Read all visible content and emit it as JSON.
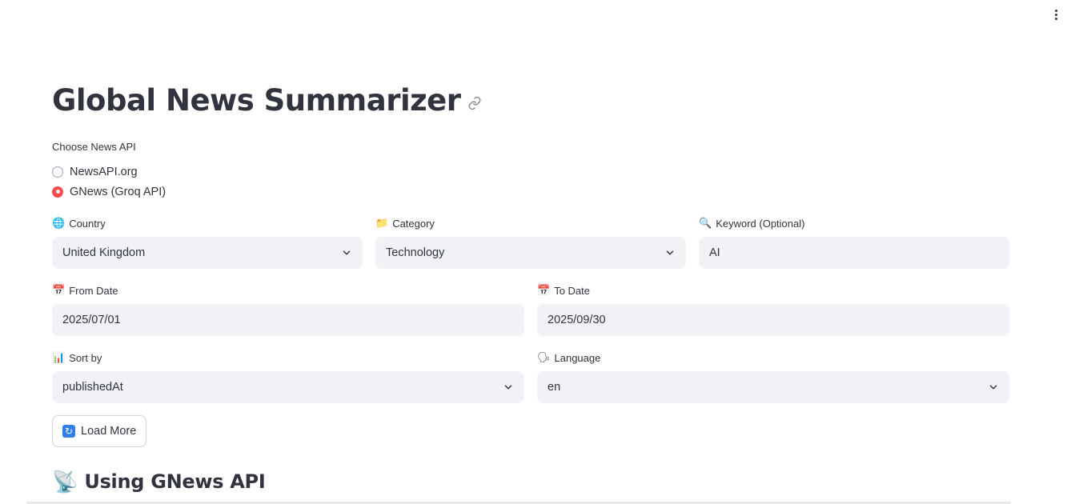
{
  "page": {
    "title": "Global News Summarizer",
    "link_icon": "link-icon",
    "menu_icon": "vertical-dots-icon"
  },
  "api_selector": {
    "label": "Choose News API",
    "options": [
      {
        "label": "NewsAPI.org",
        "selected": false
      },
      {
        "label": "GNews (Groq API)",
        "selected": true
      }
    ]
  },
  "country": {
    "emoji": "🌐",
    "label": "Country",
    "value": "United Kingdom"
  },
  "category": {
    "emoji": "📁",
    "label": "Category",
    "value": "Technology"
  },
  "keyword": {
    "emoji": "🔍",
    "label": "Keyword (Optional)",
    "value": "AI"
  },
  "from_date": {
    "emoji": "📅",
    "label": "From Date",
    "value": "2025/07/01"
  },
  "to_date": {
    "emoji": "📅",
    "label": "To Date",
    "value": "2025/09/30"
  },
  "sort_by": {
    "emoji": "📊",
    "label": "Sort by",
    "value": "publishedAt"
  },
  "language": {
    "emoji": "🗣",
    "label": "Language",
    "value": "en"
  },
  "load_more": {
    "emoji": "🔄",
    "label": "Load More"
  },
  "section": {
    "emoji": "📡",
    "heading": "Using GNews API"
  },
  "colors": {
    "accent": "#ff4b4b",
    "input_bg": "#f0f2f6",
    "text": "#31333f"
  }
}
